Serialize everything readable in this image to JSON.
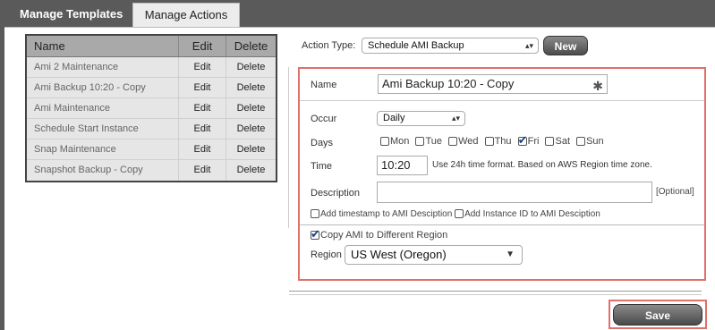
{
  "tabs": [
    {
      "label": "Manage Templates",
      "active": false
    },
    {
      "label": "Manage Actions",
      "active": true
    }
  ],
  "table": {
    "headers": {
      "name": "Name",
      "edit": "Edit",
      "delete": "Delete"
    },
    "rows": [
      {
        "name": "Ami 2 Maintenance",
        "edit": "Edit",
        "delete": "Delete"
      },
      {
        "name": "Ami Backup 10:20 - Copy",
        "edit": "Edit",
        "delete": "Delete"
      },
      {
        "name": "Ami Maintenance",
        "edit": "Edit",
        "delete": "Delete"
      },
      {
        "name": "Schedule Start Instance",
        "edit": "Edit",
        "delete": "Delete"
      },
      {
        "name": "Snap Maintenance",
        "edit": "Edit",
        "delete": "Delete"
      },
      {
        "name": "Snapshot Backup - Copy",
        "edit": "Edit",
        "delete": "Delete"
      }
    ]
  },
  "action_type": {
    "label": "Action Type:",
    "value": "Schedule AMI Backup",
    "new_button": "New"
  },
  "form": {
    "name_label": "Name",
    "name_value": "Ami Backup 10:20 - Copy",
    "occur_label": "Occur",
    "occur_value": "Daily",
    "days_label": "Days",
    "days": [
      {
        "label": "Mon",
        "checked": false
      },
      {
        "label": "Tue",
        "checked": false
      },
      {
        "label": "Wed",
        "checked": false
      },
      {
        "label": "Thu",
        "checked": false
      },
      {
        "label": "Fri",
        "checked": true
      },
      {
        "label": "Sat",
        "checked": false
      },
      {
        "label": "Sun",
        "checked": false
      }
    ],
    "time_label": "Time",
    "time_value": "10:20",
    "time_hint": "Use 24h time format. Based on AWS Region time zone.",
    "description_label": "Description",
    "description_value": "",
    "optional_label": "[Optional]",
    "add_timestamp_label": "Add timestamp to AMI Desciption",
    "add_timestamp_checked": false,
    "add_instance_label": "Add Instance ID to AMI Desciption",
    "add_instance_checked": false,
    "copy_region_label": "Copy AMI to Different Region",
    "copy_region_checked": true,
    "region_label": "Region",
    "region_value": "US West (Oregon)"
  },
  "save_button": "Save",
  "colors": {
    "highlight": "#e0706a",
    "tab_bar": "#5a5a5a",
    "check": "#1a3f8a"
  }
}
